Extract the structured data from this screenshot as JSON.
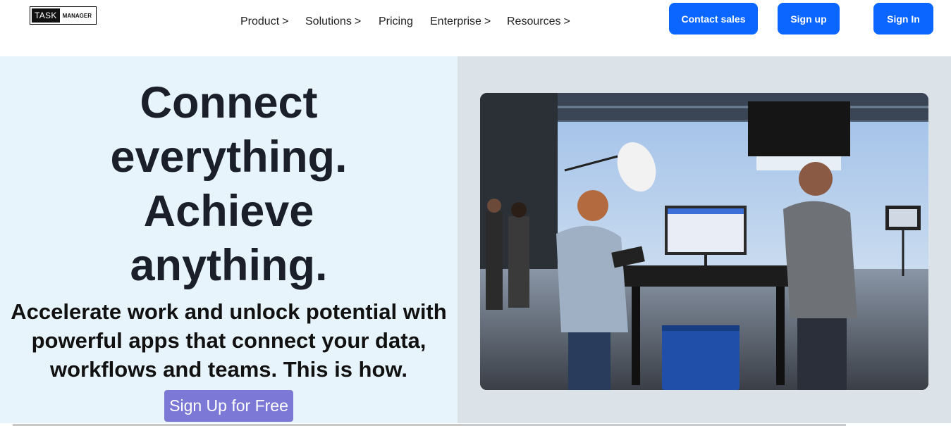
{
  "header": {
    "logo": {
      "left_text": "TASK",
      "right_text": "MANAGER"
    },
    "nav": [
      {
        "label": "Product",
        "chevron": ">"
      },
      {
        "label": "Solutions",
        "chevron": ">"
      },
      {
        "label": "Pricing",
        "chevron": ""
      },
      {
        "label": "Enterprise",
        "chevron": ">"
      },
      {
        "label": "Resources",
        "chevron": ">"
      }
    ],
    "buttons": {
      "contact_sales": "Contact sales",
      "sign_up": "Sign up",
      "sign_in": "Sign In"
    }
  },
  "hero": {
    "headline": [
      "Connect",
      "everything.",
      "Achieve",
      "anything."
    ],
    "subhead": [
      "Accelerate work and unlock potential with",
      "powerful apps that connect your data,",
      "workflows and teams. This is how."
    ],
    "cta": "Sign Up for Free"
  },
  "colors": {
    "primary_button": "#0a66ff",
    "cta_button": "#7b78d6",
    "hero_left_bg": "#e8f4fc",
    "hero_right_bg": "#dce3e8",
    "text_dark": "#1a1f29"
  }
}
